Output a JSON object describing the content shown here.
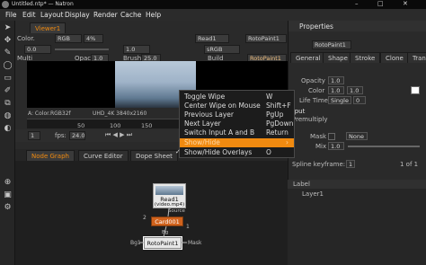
{
  "window": {
    "title": "Untitled.ntp* — Natron",
    "min": "–",
    "max": "□",
    "close": "✕"
  },
  "menubar": [
    "File",
    "Edit",
    "Layout",
    "Display",
    "Render",
    "Cache",
    "Help"
  ],
  "viewer": {
    "tab": "Viewer1",
    "row1": {
      "layers": "Color.",
      "channels": "RGB",
      "zoom": "4%",
      "in": "Read1",
      "out": "RotoPaint1"
    },
    "row2": {
      "a": "0.0",
      "gain": "1.0",
      "gamma": "1.0",
      "colorspace": "sRGB"
    },
    "row3": {
      "multi": "Multi",
      "opac": "Opac",
      "opac_val": "1.0",
      "brush": "Brush",
      "brush_val": "25.0",
      "build": "Build"
    },
    "row3_right_tab": "RotoPaint1",
    "info_left": "A: Color.RGB32f",
    "info_right": "UHD_4K 3840x2160",
    "timeline_ticks": [
      "50",
      "100",
      "150"
    ],
    "fps_label": "fps:",
    "fps_value": "24.0",
    "frame": "1"
  },
  "context_menu": {
    "items": [
      {
        "label": "Toggle Wipe",
        "shortcut": "W"
      },
      {
        "label": "Center Wipe on Mouse",
        "shortcut": "Shift+F"
      },
      {
        "label": "Previous Layer",
        "shortcut": "PgUp"
      },
      {
        "label": "Next Layer",
        "shortcut": "PgDown"
      },
      {
        "label": "Switch Input A and B",
        "shortcut": "Return"
      },
      {
        "label": "Show/Hide",
        "shortcut": "›"
      },
      {
        "label": "Show/Hide Overlays",
        "shortcut": "O"
      }
    ],
    "checked_item": "✓"
  },
  "bottom_tabs": [
    "Node Graph",
    "Curve Editor",
    "Dope Sheet"
  ],
  "nodes": {
    "read": {
      "label": "Read1",
      "sub": "(video.mp4)",
      "source": "Source"
    },
    "card": {
      "label": "Card001",
      "num_left": "2",
      "num_right": "1"
    },
    "bg": "Bg",
    "bg1": "Bg1",
    "roto": {
      "label": "RotoPaint1",
      "hash": "#"
    },
    "mask": "Mask"
  },
  "properties": {
    "title": "Properties",
    "node_name": "RotoPaint1",
    "tabs": [
      "General",
      "Shape",
      "Stroke",
      "Clone",
      "Transf"
    ],
    "opacity_label": "Opacity",
    "opacity_val": "1.0",
    "color_label": "Color",
    "color_vals": [
      "1.0",
      "1.0"
    ],
    "lifetime_label": "Life Time",
    "lifetime_val": "Single",
    "lifetime_num": "0",
    "output_label": "Output",
    "premult_label": "Premultiply",
    "mask_label": "Mask",
    "mask_val": "None",
    "mix_label": "Mix",
    "mix_val": "1.0",
    "spline_label": "Spline keyframe:",
    "spline_val": "1",
    "spline_of": "1 of 1"
  },
  "layers": {
    "label_col": "Label",
    "rows": [
      "Layer1"
    ]
  },
  "colors": {
    "accent": "#f08a10",
    "node_orange": "#d0621c",
    "node_white": "#e8e8e8"
  }
}
